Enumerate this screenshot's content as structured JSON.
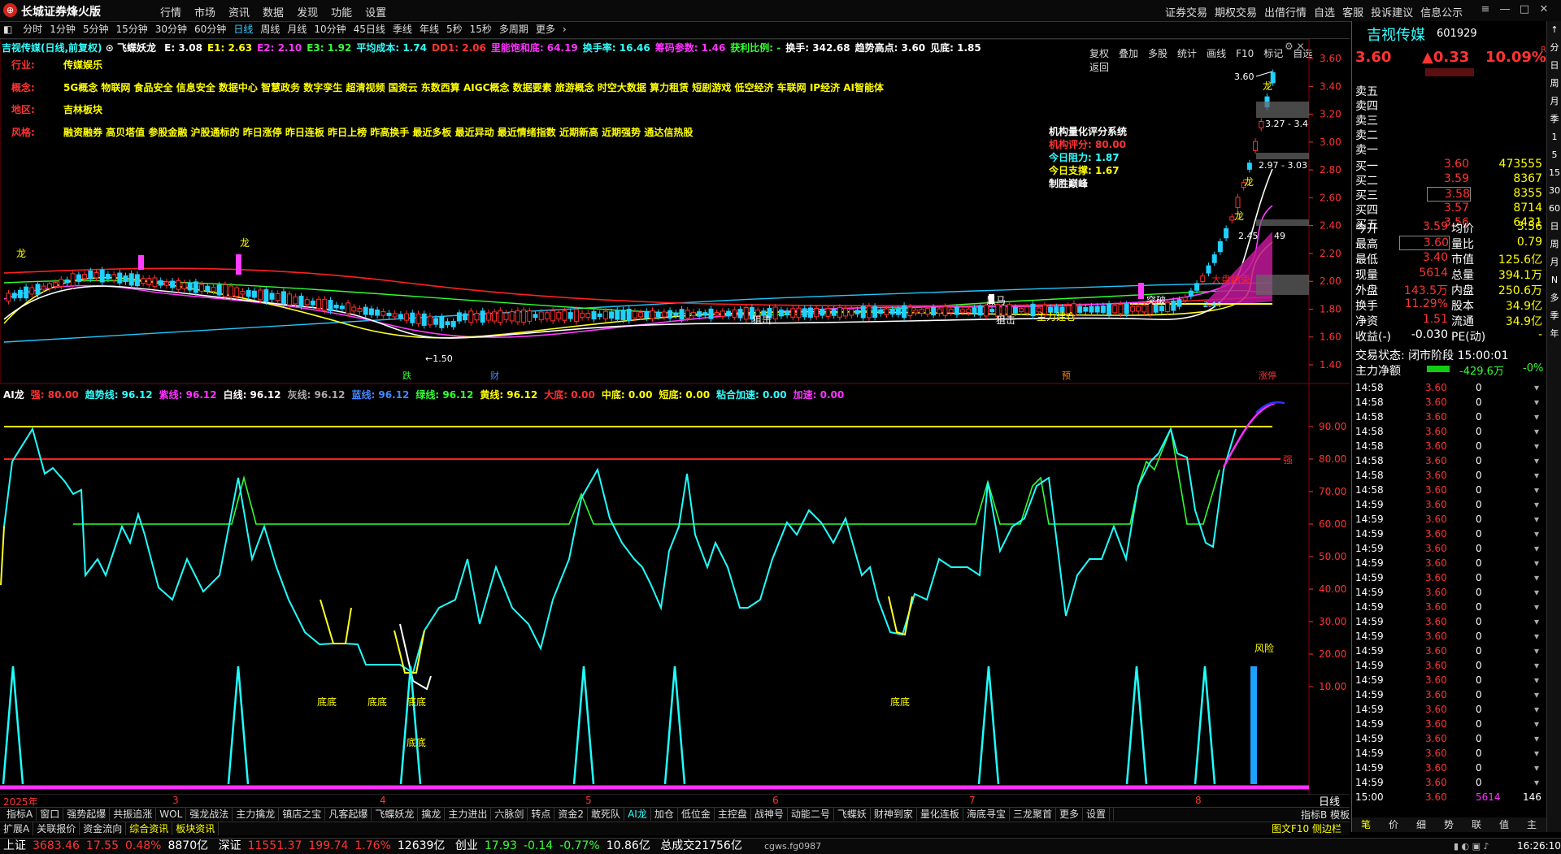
{
  "app": {
    "name": "长城证券烽火版",
    "menu": [
      "行情",
      "市场",
      "资讯",
      "数据",
      "发现",
      "功能",
      "设置"
    ],
    "right_menu": [
      "证券交易",
      "期权交易",
      "出借行情",
      "自选",
      "客服",
      "投诉建议",
      "信息公示"
    ]
  },
  "periods": [
    "分时",
    "1分钟",
    "5分钟",
    "15分钟",
    "30分钟",
    "60分钟",
    "日线",
    "周线",
    "月线",
    "10分钟",
    "45日线",
    "季线",
    "年线",
    "5秒",
    "15秒",
    "多周期",
    "更多"
  ],
  "active_period": "日线",
  "tools": [
    "复权",
    "叠加",
    "多股",
    "统计",
    "画线",
    "F10",
    "标记",
    "自选",
    "返回"
  ],
  "stock": {
    "name": "吉视传媒",
    "code": "601929",
    "price": "3.60",
    "change": "▲0.33",
    "pct": "10.09%",
    "flag": "R"
  },
  "main_info": {
    "title": "吉视传媒(日线,前复权)",
    "indicator": "飞蝶妖龙",
    "items": [
      {
        "t": "E: 3.08",
        "c": "w"
      },
      {
        "t": "E1: 2.63",
        "c": "y"
      },
      {
        "t": "E2: 2.10",
        "c": "m"
      },
      {
        "t": "E3: 1.92",
        "c": "g"
      },
      {
        "t": "平均成本: 1.74",
        "c": "c"
      },
      {
        "t": "DD1: 2.06",
        "c": "r"
      },
      {
        "t": "里能饱和底: 64.19",
        "c": "m"
      },
      {
        "t": "换手率: 16.46",
        "c": "c"
      },
      {
        "t": "筹码参数: 1.46",
        "c": "m"
      },
      {
        "t": "获利比例: -",
        "c": "g"
      },
      {
        "t": "换手: 342.68",
        "c": "w"
      },
      {
        "t": "趋势高点: 3.60",
        "c": "w"
      },
      {
        "t": "见底: 1.85",
        "c": "w"
      }
    ]
  },
  "tags": [
    {
      "label": "行业:",
      "value": "传媒娱乐"
    },
    {
      "label": "概念:",
      "value": "5G概念 物联网 食品安全 信息安全 数据中心 智慧政务 数字孪生 超清视频 国资云 东数西算 AIGC概念 数据要素 旅游概念 时空大数据 算力租赁 短剧游戏 低空经济 车联网 IP经济 AI智能体"
    },
    {
      "label": "地区:",
      "value": "吉林板块"
    },
    {
      "label": "风格:",
      "value": "融资融券 高贝塔值 参股金融 沪股通标的 昨日涨停 昨日连板 昨日上榜 昨高换手 最近多板 最近异动 最近情绪指数 近期新高 近期强势 通达信热股"
    }
  ],
  "inst_score": {
    "title": "机构量化评分系统",
    "lines": [
      "机构评分: 80.00",
      "今日阻力: 1.87",
      "今日支撑: 1.67",
      "制胜巅峰"
    ]
  },
  "price_axis": [
    "3.60",
    "3.40",
    "3.20",
    "3.00",
    "2.80",
    "2.60",
    "2.40",
    "2.20",
    "2.00",
    "1.80",
    "1.60",
    "1.40"
  ],
  "ind_axis": [
    "90.00",
    "80.00",
    "70.00",
    "60.00",
    "50.00",
    "40.00",
    "30.00",
    "20.00",
    "10.00"
  ],
  "chart_labels": {
    "low_marker": "←1.50",
    "high_marker": "3.60",
    "range1": "3.27 - 3.4",
    "range2": "2.97 - 3.03",
    "range3": "2.45",
    "range4": "49",
    "pos1": "龙",
    "hm": "黑马",
    "zl": "主力建仓",
    "tk": "突破",
    "risk": "风险",
    "strong": "强",
    "ld": "底底",
    "end_text": "大盘结束",
    "gap": "跳空",
    "jihe": "狙击",
    "low_pts": "2.44",
    "calendar_d": "跌",
    "calendar_c": "财",
    "calendar_p": "预",
    "zhangting": "涨停"
  },
  "months": [
    "2025年",
    "3",
    "4",
    "5",
    "6",
    "7",
    "8"
  ],
  "chart_data": [
    {
      "type": "line",
      "title": "吉视传媒(日线,前复权)",
      "ylim": [
        1.4,
        3.6
      ],
      "series": [
        {
          "name": "E",
          "last": 3.08
        },
        {
          "name": "E1",
          "last": 2.63
        },
        {
          "name": "E2",
          "last": 2.1
        },
        {
          "name": "E3",
          "last": 1.92
        }
      ]
    },
    {
      "type": "line",
      "title": "AI龙",
      "ylim": [
        0,
        100
      ],
      "series": [
        {
          "name": "趋势线",
          "last": 96.12
        },
        {
          "name": "紫线",
          "last": 96.12
        }
      ]
    }
  ],
  "ai_info": [
    {
      "t": "AI龙",
      "c": "w"
    },
    {
      "t": "强: 80.00",
      "c": "r"
    },
    {
      "t": "趋势线: 96.12",
      "c": "c"
    },
    {
      "t": "紫线: 96.12",
      "c": "m"
    },
    {
      "t": "白线: 96.12",
      "c": "w"
    },
    {
      "t": "灰线: 96.12",
      "c": "gr"
    },
    {
      "t": "蓝线: 96.12",
      "c": "b"
    },
    {
      "t": "绿线: 96.12",
      "c": "g"
    },
    {
      "t": "黄线: 96.12",
      "c": "y"
    },
    {
      "t": "大底: 0.00",
      "c": "r"
    },
    {
      "t": "中底: 0.00",
      "c": "y"
    },
    {
      "t": "短底: 0.00",
      "c": "y"
    },
    {
      "t": "粘合加速: 0.00",
      "c": "c"
    },
    {
      "t": "加速: 0.00",
      "c": "m"
    }
  ],
  "orderbook": {
    "sell": [
      {
        "l": "卖五"
      },
      {
        "l": "卖四"
      },
      {
        "l": "卖三"
      },
      {
        "l": "卖二"
      },
      {
        "l": "卖一"
      }
    ],
    "buy": [
      {
        "l": "买一",
        "p": "3.60",
        "v": "473555"
      },
      {
        "l": "买二",
        "p": "3.59",
        "v": "8367"
      },
      {
        "l": "买三",
        "p": "3.58",
        "v": "8355"
      },
      {
        "l": "买四",
        "p": "3.57",
        "v": "8714"
      },
      {
        "l": "买五",
        "p": "3.56",
        "v": "6431"
      }
    ]
  },
  "quote": [
    [
      "今开",
      "3.59",
      "均价",
      "3.56"
    ],
    [
      "最高",
      "3.60",
      "量比",
      "0.79"
    ],
    [
      "最低",
      "3.40",
      "市值",
      "125.6亿"
    ],
    [
      "现量",
      "5614",
      "总量",
      "394.1万"
    ],
    [
      "外盘",
      "143.5万",
      "内盘",
      "250.6万"
    ],
    [
      "换手",
      "11.29%",
      "股本",
      "34.9亿"
    ],
    [
      "净资",
      "1.51",
      "流通",
      "34.9亿"
    ],
    [
      "收益(-)",
      "-0.030",
      "PE(动)",
      "-"
    ]
  ],
  "trade_state": "交易状态: 闭市阶段 15:00:01",
  "main_flow": {
    "label": "主力净额",
    "value": "-429.6万",
    "pct": "-0%"
  },
  "ticks_time": [
    "14:58",
    "14:58",
    "14:58",
    "14:58",
    "14:58",
    "14:58",
    "14:58",
    "14:58",
    "14:59",
    "14:59",
    "14:59",
    "14:59",
    "14:59",
    "14:59",
    "14:59",
    "14:59",
    "14:59",
    "14:59",
    "14:59",
    "14:59",
    "14:59",
    "14:59",
    "14:59",
    "14:59",
    "14:59",
    "14:59",
    "14:59",
    "14:59",
    "15:00"
  ],
  "tick_price": "3.60",
  "tick_vol": "0",
  "last_tick": {
    "time": "15:00",
    "price": "3.60",
    "vol": "5614",
    "n": "146"
  },
  "tabs1": [
    "指标A",
    "窗口",
    "强势起爆",
    "共振追涨",
    "WOL",
    "强龙战法",
    "主力擒龙",
    "镇店之宝",
    "凡客起爆",
    "飞蝶妖龙",
    "擒龙",
    "主力进出",
    "六脉剑",
    "转点",
    "资金2",
    "敢死队",
    "AI龙",
    "加仓",
    "低位金",
    "主控盘",
    "战神号",
    "动能二号",
    "飞蝶妖",
    "财神到家",
    "量化连板",
    "海底寻宝",
    "三龙聚首",
    "更多",
    "设置"
  ],
  "tabs1_right": [
    "指标B",
    "模板"
  ],
  "tabs2": [
    "扩展A",
    "关联报价",
    "资金流向",
    "综合资讯",
    "板块资讯"
  ],
  "tabs2_right": [
    "图文F10",
    "侧边栏"
  ],
  "rp_tabs": [
    "笔",
    "价",
    "细",
    "势",
    "联",
    "值",
    "主"
  ],
  "day_label": "日线",
  "sidebar": [
    "↑",
    "分",
    "日",
    "周",
    "月",
    "季",
    "1",
    "5",
    "15",
    "30",
    "60",
    "日",
    "周",
    "月",
    "N",
    "多",
    "季",
    "年"
  ],
  "status": {
    "sh_label": "上证",
    "sh": "3683.46",
    "sh_chg": "17.55",
    "sh_pct": "0.48%",
    "sh_amt": "8870亿",
    "sz_label": "深证",
    "sz": "11551.37",
    "sz_chg": "199.74",
    "sz_pct": "1.76%",
    "sz_amt": "12639亿",
    "cy_label": "创业",
    "cy": "17.93",
    "cy_chg": "-0.14",
    "cy_pct": "-0.77%",
    "cy_amt": "10.86亿",
    "total": "总成交21756亿",
    "server": "cgws.fg0987",
    "time": "16:26:10"
  }
}
